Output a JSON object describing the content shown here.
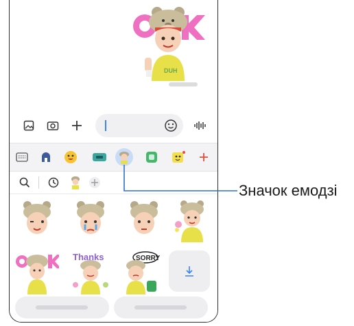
{
  "callout": {
    "label": "Значок емодзі"
  },
  "composer": {
    "icons": [
      "gallery-icon",
      "camera-icon",
      "plus-icon",
      "emoji-icon",
      "voice-icon"
    ],
    "input_placeholder": ""
  },
  "tabs": [
    "keyboard-tab",
    "home-tab",
    "emoji-tab",
    "gif-tab",
    "ar-emoji-tab",
    "sticker-tab",
    "bitmoji-tab",
    "add-tab"
  ],
  "sticker_panel": {
    "row_icons": [
      "search-icon",
      "recent-icon",
      "avatar-icon",
      "add-icon"
    ]
  },
  "stickers": {
    "row2_texts": [
      "Thanks",
      "SORRY"
    ]
  },
  "colors": {
    "accent": "#3a82f6",
    "plus_red": "#e74c3c",
    "tab_selected": "#c8dcf7"
  }
}
